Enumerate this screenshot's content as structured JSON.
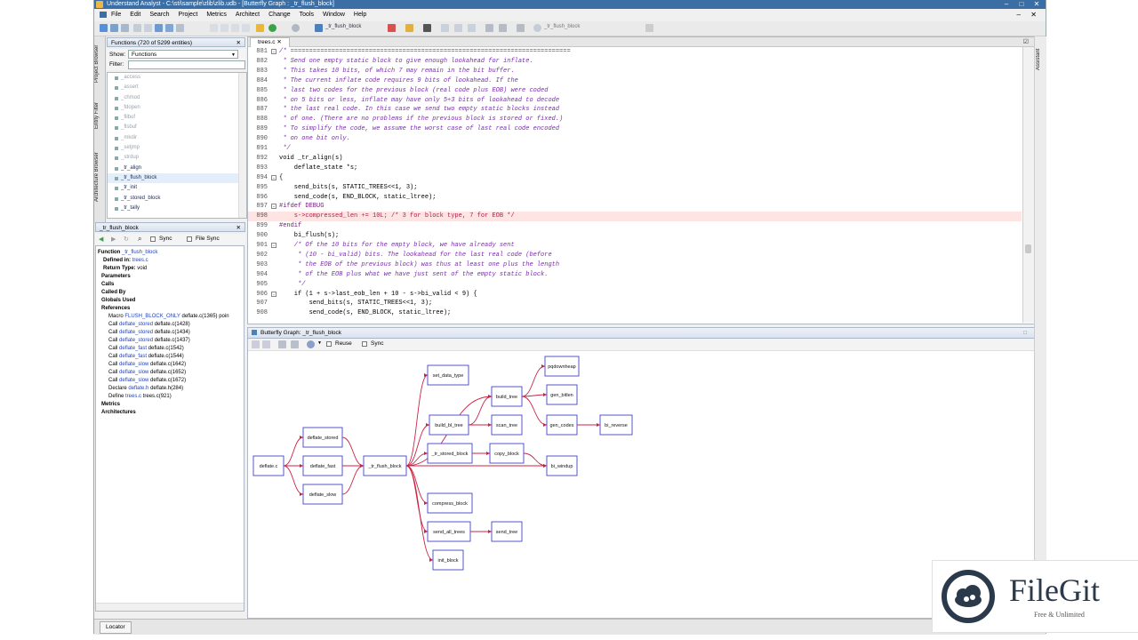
{
  "window": {
    "title": "Understand Analyst - C:\\sti\\sample\\zlib\\zlib.udb - [Butterfly Graph : _tr_flush_block]"
  },
  "menu": [
    "File",
    "Edit",
    "Search",
    "Project",
    "Metrics",
    "Architect",
    "Change",
    "Tools",
    "Window",
    "Help"
  ],
  "toolbar": {
    "entity_combo": "_tr_flush_block",
    "search_combo": "_tr_flush_block"
  },
  "vertical_tabs": [
    "Project Browser",
    "Entity Filter",
    "Architecture Browser"
  ],
  "entity_filter": {
    "title": "Functions (720 of 5299 entities)",
    "show_label": "Show:",
    "show_value": "Functions",
    "filter_label": "Filter:",
    "items": [
      {
        "label": "_access",
        "style": "faded"
      },
      {
        "label": "_assert",
        "style": "faded"
      },
      {
        "label": "_chmod",
        "style": "faded"
      },
      {
        "label": "_fdopen",
        "style": "faded"
      },
      {
        "label": "_filbuf",
        "style": "faded"
      },
      {
        "label": "_flsbuf",
        "style": "faded"
      },
      {
        "label": "_mkdir",
        "style": "faded"
      },
      {
        "label": "_setjmp",
        "style": "faded"
      },
      {
        "label": "_strdup",
        "style": "faded"
      },
      {
        "label": "_tr_align",
        "style": "dark"
      },
      {
        "label": "_tr_flush_block",
        "style": "selected"
      },
      {
        "label": "_tr_init",
        "style": "dark"
      },
      {
        "label": "_tr_stored_block",
        "style": "dark"
      },
      {
        "label": "_tr_tally",
        "style": "dark"
      }
    ]
  },
  "info_browser": {
    "title": "_tr_flush_block",
    "sync_label": "Sync",
    "file_sync_label": "File Sync",
    "function_label": "Function",
    "function_name": "_tr_flush_block",
    "defined_in_label": "Defined in:",
    "defined_in": "trees.c",
    "return_type_label": "Return Type:",
    "return_type": "void",
    "sections": [
      "Parameters",
      "Calls",
      "Called By",
      "Globals Used",
      "References"
    ],
    "references": [
      {
        "kind": "Macro",
        "name": "FLUSH_BLOCK_ONLY",
        "loc": "deflate.c(1365)",
        "extra": "poin"
      },
      {
        "kind": "Call",
        "name": "deflate_stored",
        "loc": "deflate.c(1428)"
      },
      {
        "kind": "Call",
        "name": "deflate_stored",
        "loc": "deflate.c(1434)"
      },
      {
        "kind": "Call",
        "name": "deflate_stored",
        "loc": "deflate.c(1437)"
      },
      {
        "kind": "Call",
        "name": "deflate_fast",
        "loc": "deflate.c(1542)"
      },
      {
        "kind": "Call",
        "name": "deflate_fast",
        "loc": "deflate.c(1544)"
      },
      {
        "kind": "Call",
        "name": "deflate_slow",
        "loc": "deflate.c(1642)"
      },
      {
        "kind": "Call",
        "name": "deflate_slow",
        "loc": "deflate.c(1652)"
      },
      {
        "kind": "Call",
        "name": "deflate_slow",
        "loc": "deflate.c(1672)"
      },
      {
        "kind": "Declare",
        "name": "deflate.h",
        "loc": "deflate.h(284)"
      },
      {
        "kind": "Define",
        "name": "trees.c",
        "loc": "trees.c(921)"
      }
    ],
    "tail_sections": [
      "Metrics",
      "Architectures"
    ]
  },
  "editor": {
    "tab": "trees.c",
    "lines": [
      {
        "n": "881",
        "t": "/* ===========================================================================",
        "c": "cm",
        "f": "-"
      },
      {
        "n": "882",
        "t": " * Send one empty static block to give enough lookahead for inflate.",
        "c": "cm"
      },
      {
        "n": "883",
        "t": " * This takes 10 bits, of which 7 may remain in the bit buffer.",
        "c": "cm"
      },
      {
        "n": "884",
        "t": " * The current inflate code requires 9 bits of lookahead. If the",
        "c": "cm"
      },
      {
        "n": "885",
        "t": " * last two codes for the previous block (real code plus EOB) were coded",
        "c": "cm"
      },
      {
        "n": "886",
        "t": " * on 5 bits or less, inflate may have only 5+3 bits of lookahead to decode",
        "c": "cm"
      },
      {
        "n": "887",
        "t": " * the last real code. In this case we send two empty static blocks instead",
        "c": "cm"
      },
      {
        "n": "888",
        "t": " * of one. (There are no problems if the previous block is stored or fixed.)",
        "c": "cm"
      },
      {
        "n": "889",
        "t": " * To simplify the code, we assume the worst case of last real code encoded",
        "c": "cm"
      },
      {
        "n": "890",
        "t": " * on one bit only.",
        "c": "cm"
      },
      {
        "n": "891",
        "t": " */",
        "c": "cm"
      },
      {
        "n": "892",
        "t": "void _tr_align(s)",
        "c": ""
      },
      {
        "n": "893",
        "t": "    deflate_state *s;",
        "c": ""
      },
      {
        "n": "894",
        "t": "{",
        "c": "",
        "f": "-"
      },
      {
        "n": "895",
        "t": "    send_bits(s, STATIC_TREES<<1, 3);",
        "c": ""
      },
      {
        "n": "896",
        "t": "    send_code(s, END_BLOCK, static_ltree);",
        "c": ""
      },
      {
        "n": "897",
        "t": "#ifdef DEBUG",
        "c": "pp",
        "f": "-"
      },
      {
        "n": "898",
        "t": "    s->compressed_len += 10L; /* 3 for block type, 7 for EOB */",
        "c": "hl"
      },
      {
        "n": "899",
        "t": "#endif",
        "c": "pp"
      },
      {
        "n": "900",
        "t": "    bi_flush(s);",
        "c": ""
      },
      {
        "n": "901",
        "t": "    /* Of the 10 bits for the empty block, we have already sent",
        "c": "cm",
        "f": "-"
      },
      {
        "n": "902",
        "t": "     * (10 - bi_valid) bits. The lookahead for the last real code (before",
        "c": "cm"
      },
      {
        "n": "903",
        "t": "     * the EOB of the previous block) was thus at least one plus the length",
        "c": "cm"
      },
      {
        "n": "904",
        "t": "     * of the EOB plus what we have just sent of the empty static block.",
        "c": "cm"
      },
      {
        "n": "905",
        "t": "     */",
        "c": "cm"
      },
      {
        "n": "906",
        "t": "    if (1 + s->last_eob_len + 10 - s->bi_valid < 9) {",
        "c": "",
        "f": "-"
      },
      {
        "n": "907",
        "t": "        send_bits(s, STATIC_TREES<<1, 3);",
        "c": ""
      },
      {
        "n": "908",
        "t": "        send_code(s, END_BLOCK, static_ltree);",
        "c": ""
      }
    ]
  },
  "butterfly": {
    "title": "Butterfly Graph: _tr_flush_block",
    "reuse_label": "Reuse",
    "sync_label": "Sync",
    "nodes": {
      "deflate_c": "deflate.c",
      "deflate_stored": "deflate_stored",
      "deflate_fast": "deflate_fast",
      "deflate_slow": "deflate_slow",
      "tr_flush_block": "_tr_flush_block",
      "set_data_type": "set_data_type",
      "build_bl_tree": "build_bl_tree",
      "tr_stored_block": "_tr_stored_block",
      "compress_block": "compress_block",
      "send_all_trees": "send_all_trees",
      "init_block": "init_block",
      "build_tree": "build_tree",
      "scan_tree": "scan_tree",
      "copy_block": "copy_block",
      "send_tree": "send_tree",
      "pqdownheap": "pqdownheap",
      "gen_bitlen": "gen_bitlen",
      "gen_codes": "gen_codes",
      "bi_reverse": "bi_reverse",
      "bi_windup": "bi_windup"
    }
  },
  "assistant_tab": "Assistant",
  "status": {
    "locator": "Locator"
  },
  "watermark": {
    "brand": "FileGit",
    "tagline": "Free & Unlimited"
  },
  "colors": {
    "titlebar": "#3a6ea5",
    "edge": "#cc2244",
    "node_border": "#5555cc",
    "comment": "#7a2ab0",
    "highlight_line": "#ffe4e4"
  }
}
